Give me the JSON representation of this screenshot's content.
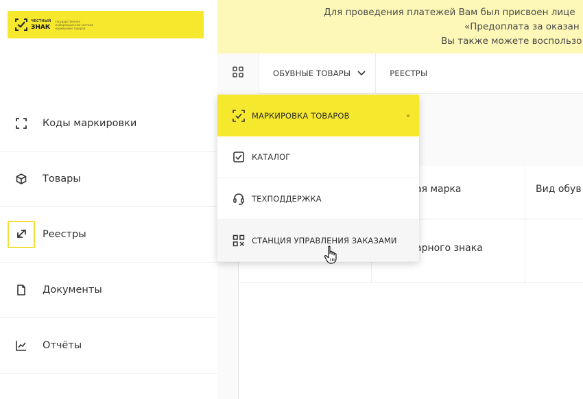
{
  "logo": {
    "small": "ЧЕСТНЫЙ",
    "big": "ЗНАК",
    "tagline": [
      "государственная",
      "информационная система",
      "маркировки товаров"
    ]
  },
  "sidebar": {
    "items": [
      {
        "label": "Коды маркировки",
        "icon": "scan-frame-icon"
      },
      {
        "label": "Товары",
        "icon": "cube-icon"
      },
      {
        "label": "Реестры",
        "icon": "swap-arrows-icon",
        "active": true
      },
      {
        "label": "Документы",
        "icon": "document-icon"
      },
      {
        "label": "Отчёты",
        "icon": "chart-trend-icon"
      }
    ]
  },
  "banner": {
    "lines": [
      "Для проведения платежей Вам был присвоен лице",
      "«Предоплата за оказан",
      "Вы также можете воспользо"
    ]
  },
  "topnav": {
    "category": "ОБУВНЫЕ ТОВАРЫ",
    "registries": "РЕЕСТРЫ"
  },
  "dropdown": {
    "items": [
      {
        "label": "МАРКИРОВКА ТОВАРОВ",
        "icon": "check-scan-icon",
        "active": true
      },
      {
        "label": "КАТАЛОГ",
        "icon": "catalog-check-icon"
      },
      {
        "label": "ТЕХПОДДЕРЖКА",
        "icon": "headset-icon"
      },
      {
        "label": "СТАНЦИЯ УПРАВЛЕНИЯ ЗАКАЗАМИ",
        "icon": "qr-code-icon",
        "hover": true
      }
    ]
  },
  "table": {
    "headers": [
      "ая марка",
      "Вид обув"
    ],
    "row1": [
      "арного знака"
    ]
  },
  "colors": {
    "brand_yellow": "#f6e82c",
    "banner_yellow": "#fdf7b8",
    "active_border": "#f1e03a"
  }
}
